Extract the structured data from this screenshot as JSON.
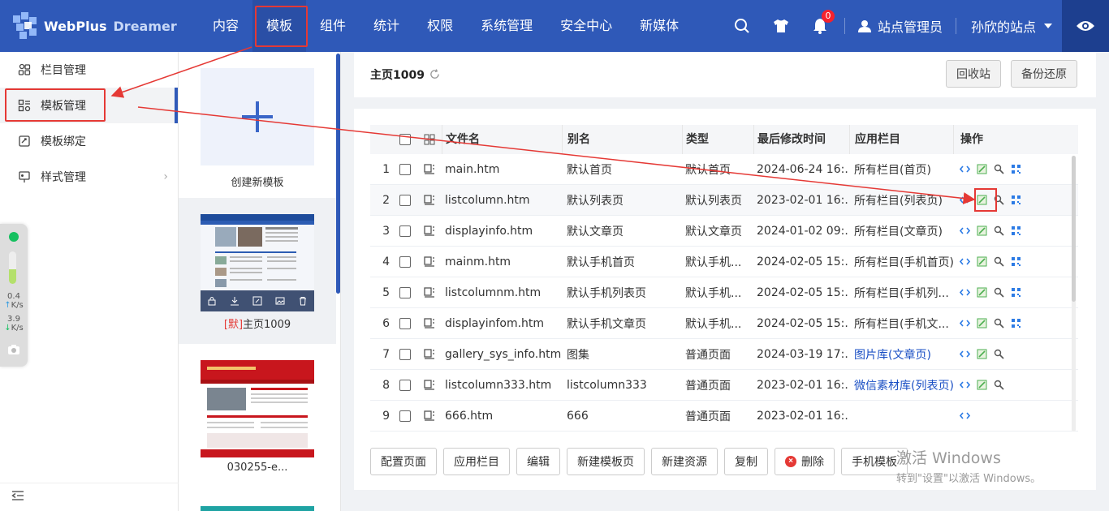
{
  "brand": {
    "name": "WebPlus",
    "sub": "Dreamer"
  },
  "nav": [
    {
      "label": "内容"
    },
    {
      "label": "模板"
    },
    {
      "label": "组件"
    },
    {
      "label": "统计"
    },
    {
      "label": "权限"
    },
    {
      "label": "系统管理"
    },
    {
      "label": "安全中心"
    },
    {
      "label": "新媒体"
    }
  ],
  "nav_active": "模板",
  "header_right": {
    "notifications": "0",
    "user": "站点管理员",
    "site": "孙欣的站点"
  },
  "sidebar": {
    "items": [
      {
        "label": "栏目管理"
      },
      {
        "label": "模板管理"
      },
      {
        "label": "模板绑定"
      },
      {
        "label": "样式管理"
      }
    ],
    "active": "模板管理"
  },
  "speed_widget": {
    "up": "0.4",
    "down": "3.9",
    "unit": "K/s"
  },
  "templates": {
    "new_label": "创建新模板",
    "items": [
      {
        "prefix": "[默]",
        "name": "主页1009"
      },
      {
        "prefix": "",
        "name": "030255-e..."
      }
    ]
  },
  "page": {
    "title": "主页1009",
    "recycle": "回收站",
    "backup": "备份还原"
  },
  "table": {
    "headers": {
      "file": "文件名",
      "alias": "别名",
      "type": "类型",
      "time": "最后修改时间",
      "column": "应用栏目",
      "ops": "操作"
    },
    "rows": [
      {
        "num": "1",
        "file": "main.htm",
        "alias": "默认首页",
        "type": "默认首页",
        "time": "2024-06-24 16:...",
        "column": "所有栏目(首页)",
        "ops": 4
      },
      {
        "num": "2",
        "file": "listcolumn.htm",
        "alias": "默认列表页",
        "type": "默认列表页",
        "time": "2023-02-01 16:...",
        "column": "所有栏目(列表页)",
        "ops": 4
      },
      {
        "num": "3",
        "file": "displayinfo.htm",
        "alias": "默认文章页",
        "type": "默认文章页",
        "time": "2024-01-02 09:...",
        "column": "所有栏目(文章页)",
        "ops": 4
      },
      {
        "num": "4",
        "file": "mainm.htm",
        "alias": "默认手机首页",
        "type": "默认手机...",
        "time": "2024-02-05 15:...",
        "column": "所有栏目(手机首页)",
        "ops": 4
      },
      {
        "num": "5",
        "file": "listcolumnm.htm",
        "alias": "默认手机列表页",
        "type": "默认手机...",
        "time": "2024-02-05 15:...",
        "column": "所有栏目(手机列...",
        "ops": 4
      },
      {
        "num": "6",
        "file": "displayinfom.htm",
        "alias": "默认手机文章页",
        "type": "默认手机...",
        "time": "2024-02-05 15:...",
        "column": "所有栏目(手机文...",
        "ops": 4
      },
      {
        "num": "7",
        "file": "gallery_sys_info.htm",
        "alias": "图集",
        "type": "普通页面",
        "time": "2024-03-19 17:...",
        "column": "图片库(文章页)",
        "column_link": true,
        "ops": 3
      },
      {
        "num": "8",
        "file": "listcolumn333.htm",
        "alias": "listcolumn333",
        "type": "普通页面",
        "time": "2023-02-01 16:...",
        "column": "微信素材库(列表页)",
        "column_link": true,
        "ops": 3
      },
      {
        "num": "9",
        "file": "666.htm",
        "alias": "666",
        "type": "普通页面",
        "time": "2023-02-01 16:...",
        "column": "",
        "ops": 1
      }
    ]
  },
  "buttons": [
    "配置页面",
    "应用栏目",
    "编辑",
    "新建模板页",
    "新建资源",
    "复制",
    "删除",
    "手机模板"
  ],
  "watermark": {
    "line1": "激活 Windows",
    "line2": "转到\"设置\"以激活 Windows。"
  },
  "colors": {
    "nav_bg": "#2f59b8",
    "highlight": "#e53935",
    "link": "#1a4fc4"
  }
}
